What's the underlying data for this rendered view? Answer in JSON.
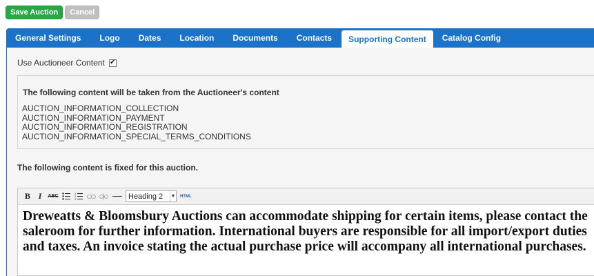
{
  "actions": {
    "save_label": "Save Auction",
    "cancel_label": "Cancel"
  },
  "tabs": [
    {
      "label": "General Settings",
      "active": false
    },
    {
      "label": "Logo",
      "active": false
    },
    {
      "label": "Dates",
      "active": false
    },
    {
      "label": "Location",
      "active": false
    },
    {
      "label": "Documents",
      "active": false
    },
    {
      "label": "Contacts",
      "active": false
    },
    {
      "label": "Supporting Content",
      "active": true
    },
    {
      "label": "Catalog Config",
      "active": false
    }
  ],
  "use_auctioneer": {
    "label": "Use Auctioneer Content",
    "checked": true
  },
  "auctioneer_box": {
    "title": "The following content will be taken from the Auctioneer's content",
    "items": [
      "AUCTION_INFORMATION_COLLECTION",
      "AUCTION_INFORMATION_PAYMENT",
      "AUCTION_INFORMATION_REGISTRATION",
      "AUCTION_INFORMATION_SPECIAL_TERMS_CONDITIONS"
    ]
  },
  "fixed_title": "The following content is fixed for this auction.",
  "editor": {
    "toolbar": {
      "bold": "B",
      "italic": "I",
      "strike": "ABC",
      "format_selected": "Heading 2",
      "html_label": "HTML"
    },
    "content": "Dreweatts & Bloomsbury Auctions can accommodate shipping for certain items, please contact the saleroom for further information. International buyers are responsible for all import/export duties and taxes. An invoice stating the actual purchase price will accompany all international purchases."
  },
  "colors": {
    "accent": "#1a73c9",
    "save": "#28a745",
    "cancel": "#c0c0c0"
  }
}
